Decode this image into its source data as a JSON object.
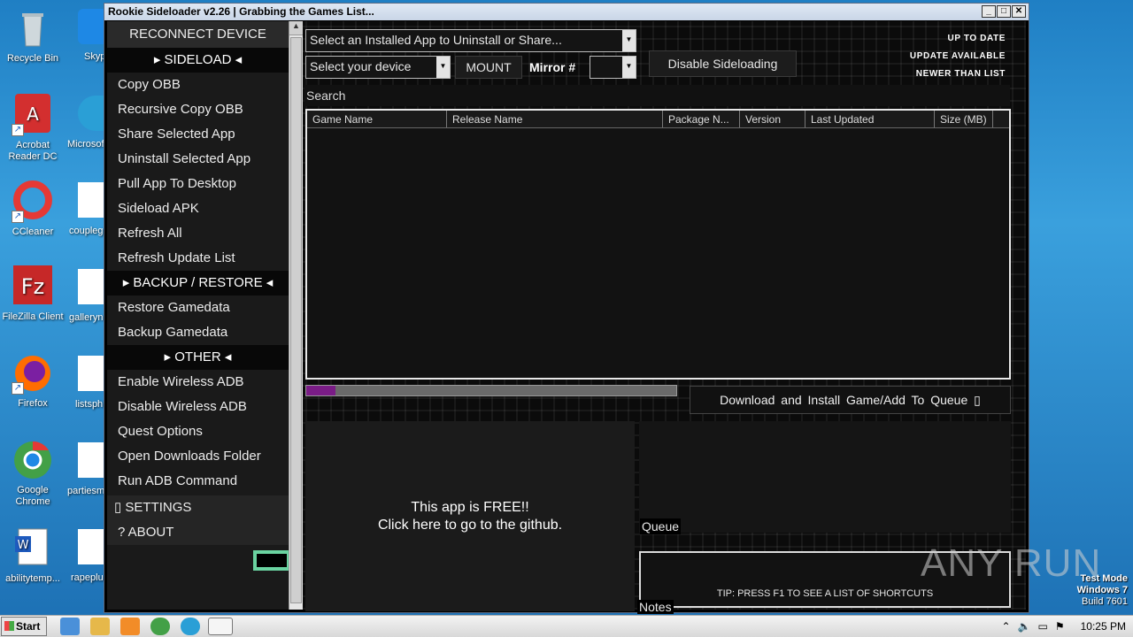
{
  "desktop": {
    "icons": [
      {
        "label": "Recycle Bin"
      },
      {
        "label": "Acrobat Reader DC"
      },
      {
        "label": "CCleaner"
      },
      {
        "label": "FileZilla Client"
      },
      {
        "label": "Firefox"
      },
      {
        "label": "Google Chrome"
      },
      {
        "label": "abilitytemp..."
      }
    ],
    "partial_labels": [
      "Skyp",
      "Microsof",
      "couplegr",
      "galleryn",
      "listsph",
      "partiesm",
      "rapeplu"
    ]
  },
  "window": {
    "title": "Rookie Sideloader v2.26 | Grabbing the Games List...",
    "controls": {
      "minimize": "_",
      "maximize": "□",
      "close": "✕"
    }
  },
  "sidebar": {
    "reconnect": "RECONNECT DEVICE",
    "sideload_header": "▸ SIDELOAD ◂",
    "sideload_items": [
      "Copy OBB",
      "Recursive Copy OBB",
      "Share Selected App",
      "Uninstall Selected App",
      "Pull App To Desktop",
      "Sideload APK",
      "Refresh All",
      "Refresh Update List"
    ],
    "backup_header": "▸ BACKUP / RESTORE ◂",
    "backup_items": [
      "Restore Gamedata",
      "Backup Gamedata"
    ],
    "other_header": "▸ OTHER ◂",
    "other_items": [
      "Enable  Wireless ADB",
      "Disable Wireless ADB",
      "Quest Options",
      "Open Downloads Folder",
      "Run ADB Command"
    ],
    "settings": "▯ SETTINGS",
    "about": "?   ABOUT"
  },
  "toolbar": {
    "installed_app_select": "Select an Installed App to Uninstall or Share...",
    "device_select": "Select your device",
    "mount_button": "MOUNT",
    "mirror_label": "Mirror #",
    "mirror_value": "",
    "disable_sideloading": "Disable Sideloading"
  },
  "legend": {
    "up_to_date": "UP TO DATE",
    "update_available": "UPDATE AVAILABLE",
    "newer_than_list": "NEWER THAN LIST",
    "colors": {
      "up_to_date": "#ffffff",
      "update_available": "#ffffff",
      "newer_than_list": "#ffffff"
    }
  },
  "search": {
    "label": "Search"
  },
  "games_table": {
    "columns": [
      "Game Name",
      "Release Name",
      "Package N...",
      "Version",
      "Last Updated",
      "Size (MB)"
    ],
    "rows": []
  },
  "progress": {
    "value_percent": 8,
    "color": "#7a1c86"
  },
  "download_button": "Download  and  Install  Game/Add  To  Queue ▯",
  "free_panel": {
    "line1": "This app is FREE!!",
    "line2": "Click here to go to the github."
  },
  "queue": {
    "label": "Queue"
  },
  "notes": {
    "label": "Notes",
    "tip": "TIP: PRESS F1 TO SEE A LIST OF SHORTCUTS"
  },
  "watermark": "ANY RUN",
  "test_mode": {
    "line1": "Test Mode",
    "line2": "Windows 7",
    "line3": "Build 7601"
  },
  "taskbar": {
    "start": "Start",
    "time": "10:25 PM"
  }
}
